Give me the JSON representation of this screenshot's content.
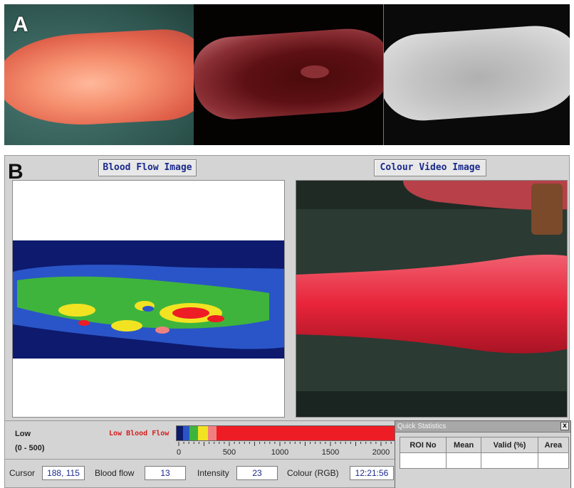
{
  "panel_a": {
    "letter": "A",
    "images": [
      "colour-photo",
      "blood-flow-overlay",
      "intensity-image"
    ]
  },
  "panel_b": {
    "letter": "B",
    "blood_flow_title": "Blood Flow Image",
    "colour_video_title": "Colour Video Image"
  },
  "legend": {
    "low": "Low",
    "range": "(0 - 500)",
    "low_blood_flow": "Low Blood Flow",
    "colors": [
      "#0d1a6e",
      "#2a55c8",
      "#3fb43c",
      "#f2e322",
      "#f08080",
      "#ee1c24"
    ],
    "scale_ticks": [
      "0",
      "500",
      "1000",
      "1500",
      "2000"
    ]
  },
  "status": {
    "cursor_label": "Cursor",
    "cursor_value": "188, 115",
    "blood_flow_label": "Blood flow",
    "blood_flow_value": "13",
    "intensity_label": "Intensity",
    "intensity_value": "23",
    "colour_label": "Colour (RGB)",
    "time_value": "12:21:56"
  },
  "quick_stats": {
    "title": "Quick Statistics",
    "close": "x",
    "columns": [
      "ROI No",
      "Mean",
      "Valid (%)",
      "Area"
    ]
  }
}
